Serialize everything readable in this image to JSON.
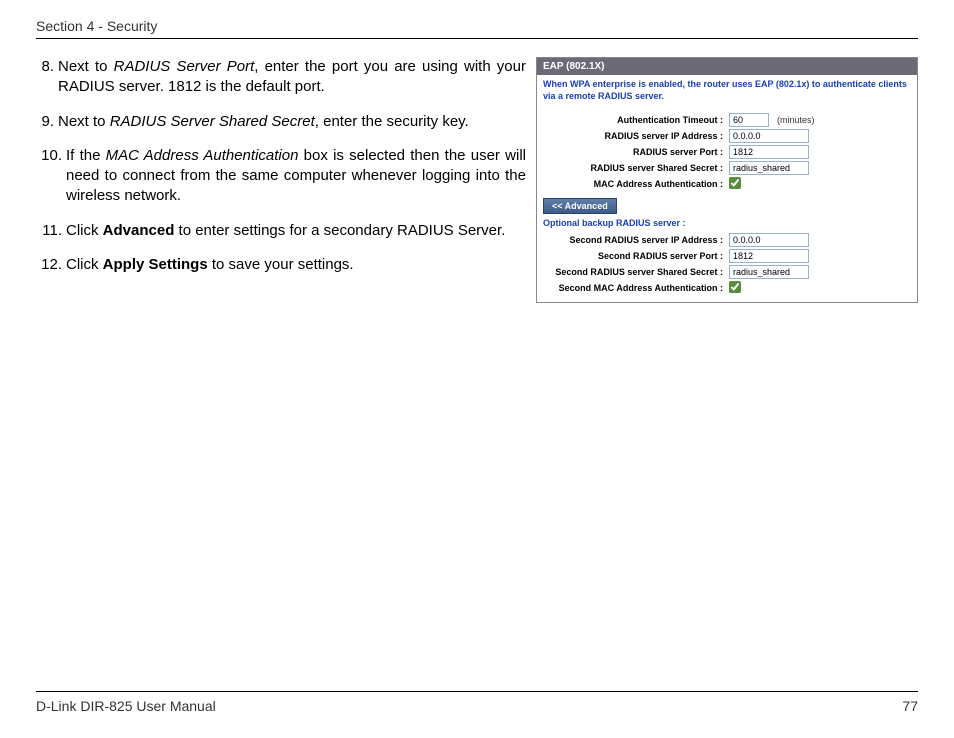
{
  "header": {
    "section": "Section 4 - Security"
  },
  "instructions": {
    "steps": [
      {
        "num": "8.",
        "html": "Next to <em>RADIUS Server Port</em>, enter the port you are using with your RADIUS server. 1812 is the default port."
      },
      {
        "num": "9.",
        "html": "Next to <em>RADIUS Server Shared Secret</em>, enter the security key."
      },
      {
        "num": "10.",
        "html": "If the <em>MAC Address Authentication</em> box is selected then the user will need to connect from the same computer whenever logging into the wireless network."
      },
      {
        "num": "11.",
        "html": "Click <strong>Advanced</strong> to enter settings for a secondary RADIUS Server."
      },
      {
        "num": "12.",
        "html": "Click <strong>Apply Settings</strong> to save your settings."
      }
    ]
  },
  "panel": {
    "title": "EAP (802.1X)",
    "note": "When WPA enterprise is enabled, the router uses EAP (802.1x) to authenticate clients via a remote RADIUS server.",
    "fields": {
      "auth_timeout_label": "Authentication Timeout :",
      "auth_timeout_value": "60",
      "auth_timeout_unit": "(minutes)",
      "radius_ip_label": "RADIUS server IP Address :",
      "radius_ip_value": "0.0.0.0",
      "radius_port_label": "RADIUS server Port :",
      "radius_port_value": "1812",
      "radius_secret_label": "RADIUS server Shared Secret :",
      "radius_secret_value": "radius_shared",
      "mac_auth_label": "MAC Address Authentication :"
    },
    "advanced_button": "<< Advanced",
    "optional_title": "Optional backup RADIUS server :",
    "backup": {
      "ip_label": "Second RADIUS server IP Address :",
      "ip_value": "0.0.0.0",
      "port_label": "Second RADIUS server Port :",
      "port_value": "1812",
      "secret_label": "Second RADIUS server Shared Secret :",
      "secret_value": "radius_shared",
      "mac_label": "Second MAC Address Authentication :"
    }
  },
  "footer": {
    "manual": "D-Link DIR-825 User Manual",
    "page": "77"
  }
}
